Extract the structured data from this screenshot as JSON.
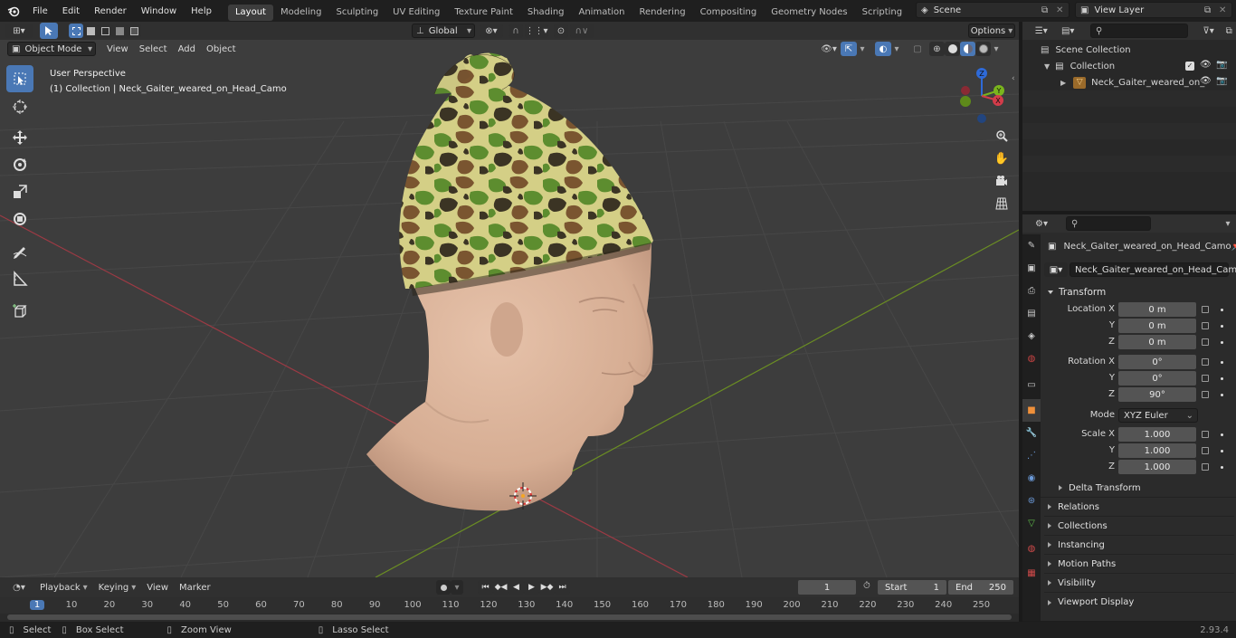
{
  "topbar": {
    "menus": [
      "File",
      "Edit",
      "Render",
      "Window",
      "Help"
    ],
    "workspaces": [
      "Layout",
      "Modeling",
      "Sculpting",
      "UV Editing",
      "Texture Paint",
      "Shading",
      "Animation",
      "Rendering",
      "Compositing",
      "Geometry Nodes",
      "Scripting"
    ],
    "active_workspace": "Layout",
    "scene": "Scene",
    "view_layer": "View Layer"
  },
  "viewport_header": {
    "mode": "Object Mode",
    "menus": [
      "View",
      "Select",
      "Add",
      "Object"
    ],
    "transform_orientation": "Global",
    "options": "Options"
  },
  "viewport": {
    "perspective": "User Perspective",
    "collection_info": "(1) Collection | Neck_Gaiter_weared_on_Head_Camo",
    "gizmo": {
      "x": "X",
      "y": "Y",
      "z": "Z"
    },
    "colors": {
      "background": "#3d3d3d",
      "grid": "#4a4a4a",
      "x_axis": "#9c3a44",
      "y_axis": "#6b8e23",
      "skin": "#d9b49c",
      "camo_dark": "#3b3424",
      "camo_brown": "#7a5530",
      "camo_green": "#5c8a2e",
      "camo_tan": "#d7d28a"
    }
  },
  "outliner": {
    "scene_collection": "Scene Collection",
    "collection": "Collection",
    "object": "Neck_Gaiter_weared_on_"
  },
  "properties": {
    "object_name": "Neck_Gaiter_weared_on_Head_Camo",
    "object_name_field": "Neck_Gaiter_weared_on_Head_Camo",
    "transform_title": "Transform",
    "location_label": "Location X",
    "location": [
      "0 m",
      "0 m",
      "0 m"
    ],
    "rotation_label": "Rotation X",
    "rotation": [
      "0°",
      "0°",
      "90°"
    ],
    "mode_label": "Mode",
    "mode": "XYZ Euler",
    "scale_label": "Scale X",
    "scale": [
      "1.000",
      "1.000",
      "1.000"
    ],
    "axis_y": "Y",
    "axis_z": "Z",
    "delta": "Delta Transform",
    "panels": [
      "Relations",
      "Collections",
      "Instancing",
      "Motion Paths",
      "Visibility",
      "Viewport Display"
    ]
  },
  "timeline": {
    "menus": [
      "Playback",
      "Keying",
      "View",
      "Marker"
    ],
    "current_frame": "1",
    "start_label": "Start",
    "start": "1",
    "end_label": "End",
    "end": "250",
    "ruler": [
      "1",
      "10",
      "20",
      "30",
      "40",
      "50",
      "60",
      "70",
      "80",
      "90",
      "100",
      "110",
      "120",
      "130",
      "140",
      "150",
      "160",
      "170",
      "180",
      "190",
      "200",
      "210",
      "220",
      "230",
      "240",
      "250"
    ]
  },
  "statusbar": {
    "select": "Select",
    "box_select": "Box Select",
    "zoom_view": "Zoom View",
    "lasso_select": "Lasso Select",
    "version": "2.93.4"
  }
}
